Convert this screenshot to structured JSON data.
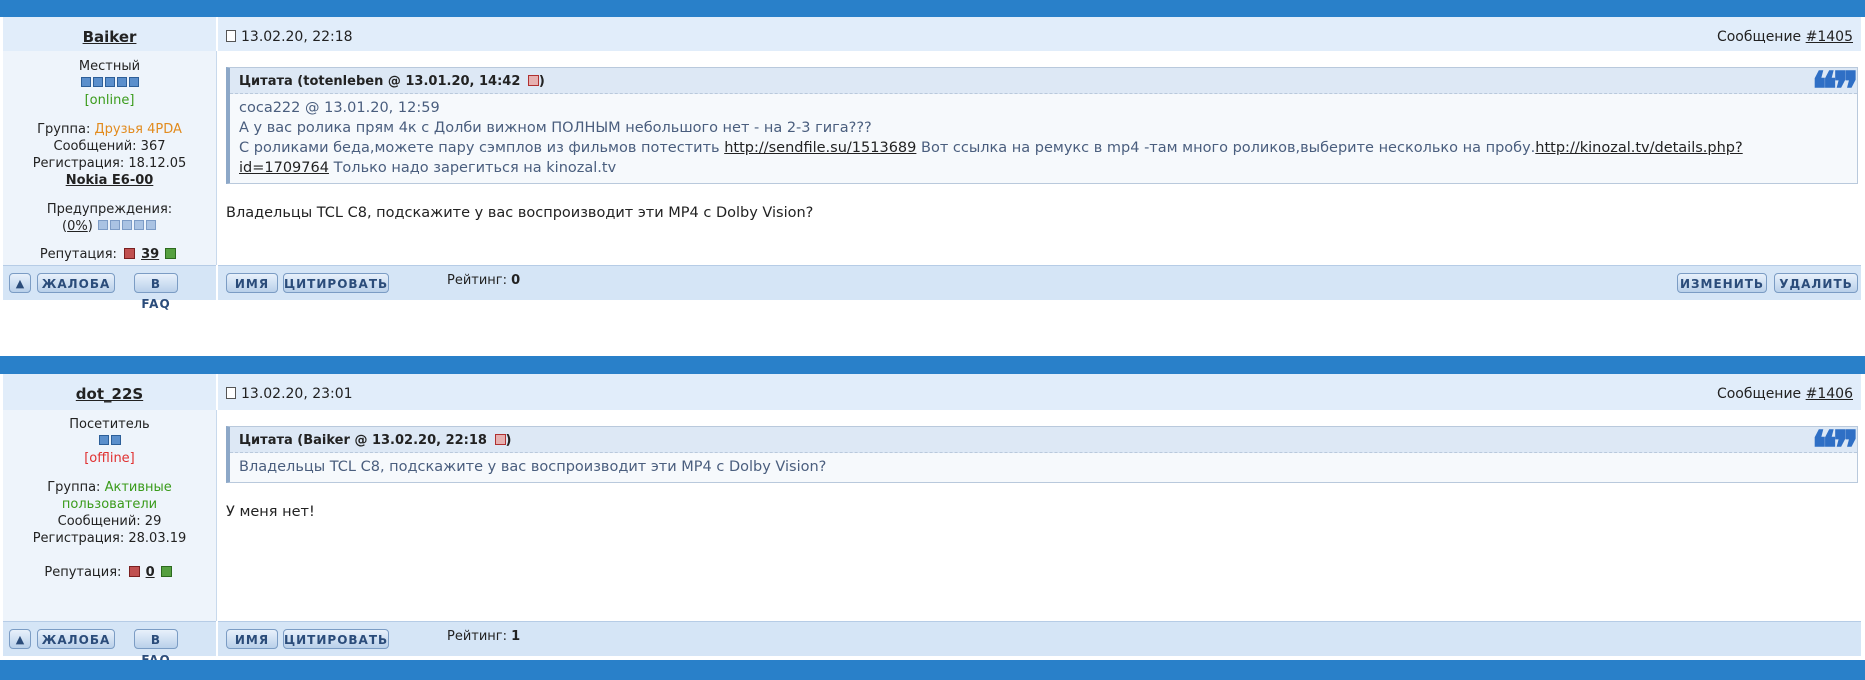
{
  "posts": [
    {
      "nick": "Baiker",
      "status": "Местный",
      "online": "[online]",
      "group_label": "Группа:",
      "group": "Друзья 4PDA",
      "posts_label": "Сообщений: 367",
      "reg_label": "Регистрация: 18.12.05",
      "device": "Nokia E6-00",
      "warn_label": "Предупреждения:",
      "warn_open": "(",
      "warn_value": "0%",
      "warn_close": ")",
      "rep_label": "Репутация:",
      "rep_value": "39",
      "date": "13.02.20, 22:18",
      "msg_label": "Сообщение",
      "msg_no": "#1405",
      "quote_header": "Цитата (totenleben @ 13.01.20, 14:42",
      "quote_header_end": ")",
      "quote_line1": "coca222 @ 13.01.20, 12:59",
      "quote_line2": "А у вас ролика прям 4к с Долби вижном ПОЛНЫМ небольшого нет - на 2-3 гига???",
      "quote_line3a": "С роликами беда,можете пару сэмплов из фильмов потестить",
      "quote_link1": "http://sendfile.su/1513689",
      "quote_line3b": "Вот ссылка на ремукс в mp4 -там много роликов,выберите несколько на пробу.",
      "quote_link2a": "http://kinozal.tv/details.php?",
      "quote_link2b": "id=1709764",
      "quote_line4": "Только надо зарегиться на kinozal.tv",
      "text": "Владельцы TCL C8, подскажите у вас воспроизводит эти MP4 с Dolby Vision?",
      "rating_label": "Рейтинг:",
      "rating_value": "0"
    },
    {
      "nick": "dot_22S",
      "status": "Посетитель",
      "online": "[offline]",
      "group_label": "Группа:",
      "group_a": "Активные",
      "group_b": "пользователи",
      "posts_label": "Сообщений: 29",
      "reg_label": "Регистрация: 28.03.19",
      "rep_label": "Репутация:",
      "rep_value": "0",
      "date": "13.02.20, 23:01",
      "msg_label": "Сообщение",
      "msg_no": "#1406",
      "quote_header": "Цитата (Baiker @ 13.02.20, 22:18",
      "quote_header_end": ")",
      "quote_line1": "Владельцы TCL C8, подскажите у вас воспроизводит эти MP4 с Dolby Vision?",
      "text": "У меня нет!",
      "rating_label": "Рейтинг:",
      "rating_value": "1"
    }
  ],
  "buttons": {
    "complaint": "ЖАЛОБА",
    "faq": "В FAQ",
    "name": "ИМЯ",
    "quote": "ЦИТИРОВАТЬ",
    "edit": "ИЗМЕНИТЬ",
    "delete": "УДАЛИТЬ",
    "up_icon": "▲"
  },
  "quote_mark": "❝❞",
  "colors": {
    "bar": "#2980c9",
    "online": "#3a9b1b",
    "offline": "#e03030",
    "group_friends": "#e28b1e"
  }
}
